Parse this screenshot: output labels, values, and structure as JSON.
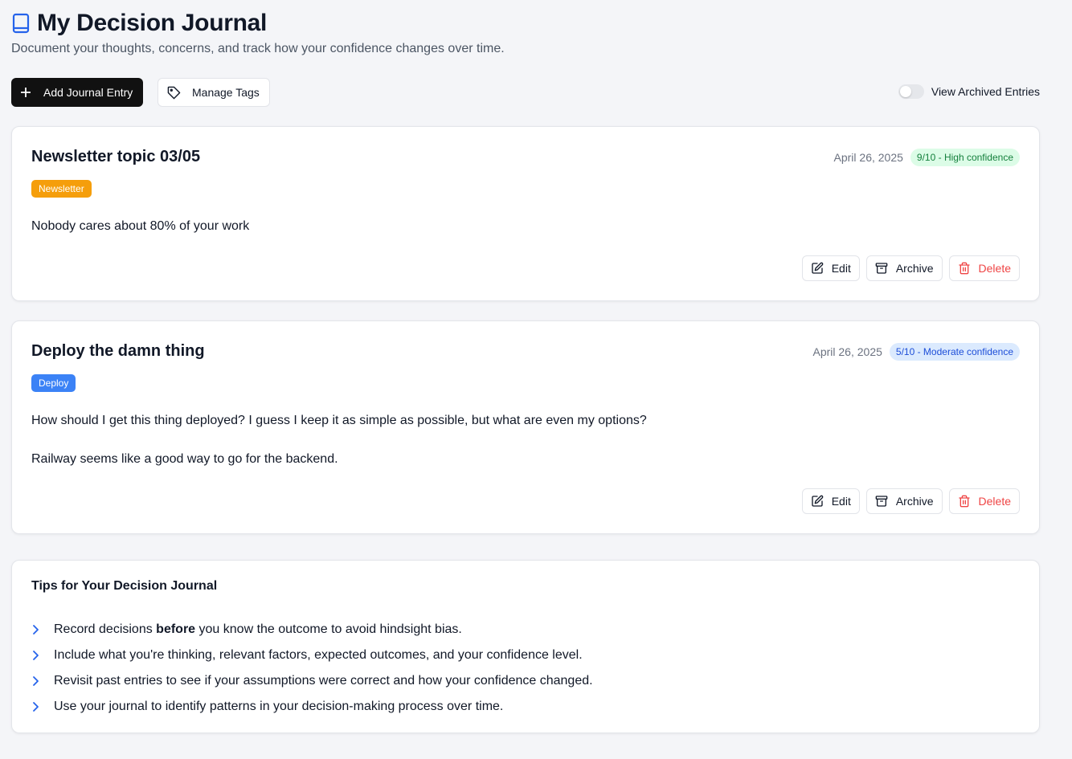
{
  "header": {
    "title": "My Decision Journal",
    "subtitle": "Document your thoughts, concerns, and track how your confidence changes over time.",
    "icon": "book-icon"
  },
  "toolbar": {
    "add_label": "Add Journal Entry",
    "manage_tags_label": "Manage Tags",
    "archived_label": "View Archived Entries",
    "archived_enabled": false
  },
  "entries": [
    {
      "title": "Newsletter topic 03/05",
      "date": "April 26, 2025",
      "confidence": "9/10 - High confidence",
      "tag": "Newsletter",
      "tag_color": "#f59e0b",
      "body": [
        "Nobody cares about 80% of your work"
      ]
    },
    {
      "title": "Deploy the damn thing",
      "date": "April 26, 2025",
      "confidence": "5/10 - Moderate confidence",
      "tag": "Deploy",
      "tag_color": "#3b82f6",
      "body": [
        "How should I get this thing deployed? I guess I keep it as simple as possible, but what are even my options?",
        "Railway seems like a good way to go for the backend."
      ]
    }
  ],
  "actions": {
    "edit": "Edit",
    "archive": "Archive",
    "delete": "Delete"
  },
  "tips": {
    "title": "Tips for Your Decision Journal",
    "item1_pre": "Record decisions ",
    "item1_bold": "before",
    "item1_post": " you know the outcome to avoid hindsight bias.",
    "item2": "Include what you're thinking, relevant factors, expected outcomes, and your confidence level.",
    "item3": "Revisit past entries to see if your assumptions were correct and how your confidence changed.",
    "item4": "Use your journal to identify patterns in your decision-making process over time."
  },
  "colors": {
    "primary_button": "#111111",
    "confidence_high_bg": "#dcfce7",
    "confidence_high_text": "#15803d",
    "confidence_moderate_bg": "#dbeafe",
    "confidence_moderate_text": "#1d4ed8",
    "delete_text": "#ef4444",
    "accent_blue": "#2563eb"
  }
}
